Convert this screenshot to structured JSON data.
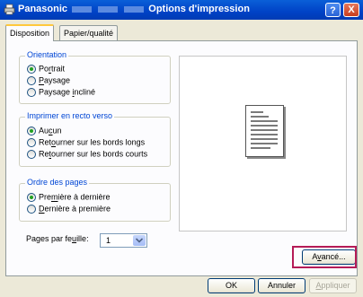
{
  "titlebar": {
    "brand": "Panasonic",
    "title": "Options d'impression",
    "help_label": "?",
    "close_label": "X"
  },
  "tabs": [
    {
      "label": "Disposition",
      "active": true
    },
    {
      "label": "Papier/qualité",
      "active": false
    }
  ],
  "orientation": {
    "label": "Orientation",
    "options": [
      {
        "pre": "Po",
        "key": "r",
        "post": "trait",
        "selected": true
      },
      {
        "pre": "",
        "key": "P",
        "post": "aysage",
        "selected": false
      },
      {
        "pre": "Paysage ",
        "key": "i",
        "post": "ncliné",
        "selected": false
      }
    ]
  },
  "duplex": {
    "label": "Imprimer en recto verso",
    "options": [
      {
        "pre": "Au",
        "key": "c",
        "post": "un",
        "selected": true
      },
      {
        "pre": "Ret",
        "key": "o",
        "post": "urner sur les bords longs",
        "selected": false
      },
      {
        "pre": "Re",
        "key": "t",
        "post": "ourner sur les bords courts",
        "selected": false
      }
    ]
  },
  "page_order": {
    "label": "Ordre des pages",
    "options": [
      {
        "pre": "Pre",
        "key": "m",
        "post": "ière à dernière",
        "selected": true
      },
      {
        "pre": "",
        "key": "D",
        "post": "ernière à première",
        "selected": false
      }
    ]
  },
  "pages_per_sheet": {
    "pre": "Pages par fe",
    "key": "u",
    "post": "ille:",
    "value": "1"
  },
  "buttons": {
    "advanced": {
      "pre": "A",
      "key": "v",
      "post": "ancé..."
    },
    "ok": "OK",
    "cancel": "Annuler",
    "apply": {
      "pre": "",
      "key": "A",
      "post": "ppliquer"
    }
  },
  "colors": {
    "titlebar": "#0a5fd8",
    "group_label": "#0046d5",
    "highlight": "#b51b57",
    "radio_selected": "#21a121"
  }
}
